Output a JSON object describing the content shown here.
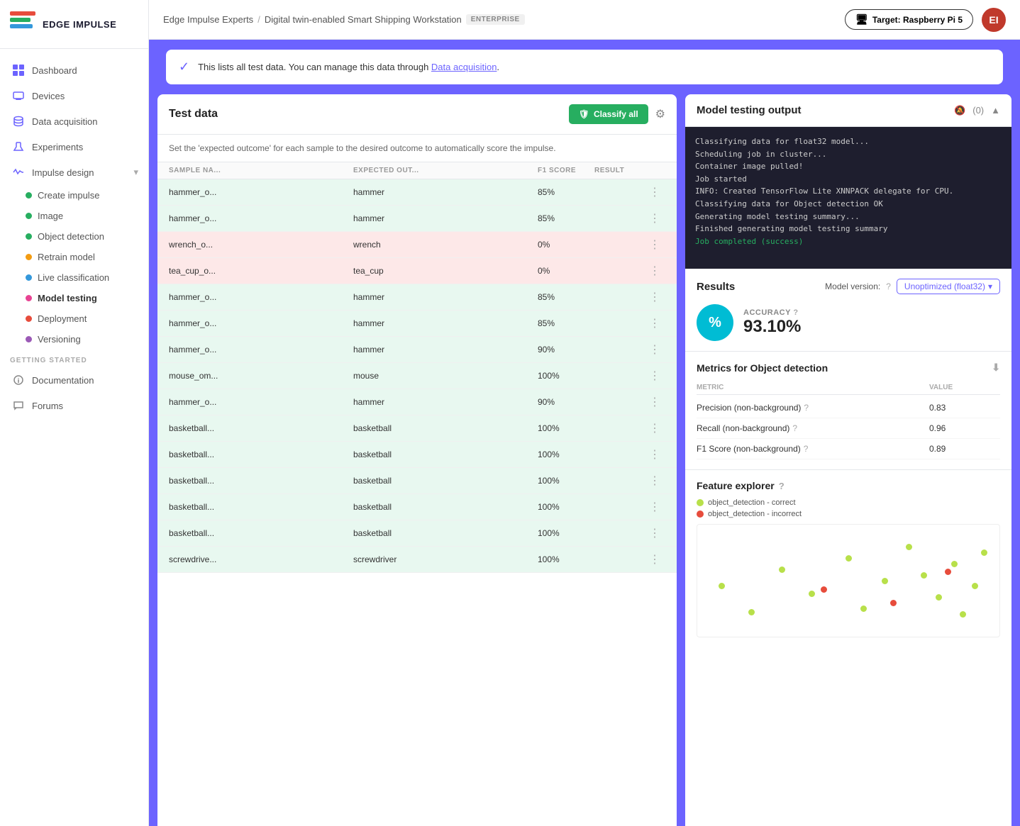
{
  "app": {
    "name": "EDGE IMPULSE"
  },
  "header": {
    "breadcrumb_project": "Edge Impulse Experts",
    "breadcrumb_sep": "/",
    "breadcrumb_page": "Digital twin-enabled Smart Shipping Workstation",
    "badge": "ENTERPRISE",
    "target_label": "Target: Raspberry Pi 5",
    "avatar_initials": "EI"
  },
  "sidebar": {
    "nav_items": [
      {
        "id": "dashboard",
        "label": "Dashboard",
        "icon": "grid"
      },
      {
        "id": "devices",
        "label": "Devices",
        "icon": "devices",
        "active": false
      },
      {
        "id": "data-acquisition",
        "label": "Data acquisition",
        "icon": "database"
      },
      {
        "id": "experiments",
        "label": "Experiments",
        "icon": "experiments"
      },
      {
        "id": "impulse-design",
        "label": "Impulse design",
        "icon": "impulse",
        "has_arrow": true
      }
    ],
    "submenu": [
      {
        "id": "create-impulse",
        "label": "Create impulse",
        "dot": "green"
      },
      {
        "id": "image",
        "label": "Image",
        "dot": "green"
      },
      {
        "id": "object-detection",
        "label": "Object detection",
        "dot": "green"
      },
      {
        "id": "retrain-model",
        "label": "Retrain model",
        "dot": "yellow"
      },
      {
        "id": "live-classification",
        "label": "Live classification",
        "dot": "blue"
      },
      {
        "id": "model-testing",
        "label": "Model testing",
        "dot": "pink",
        "active": true
      },
      {
        "id": "deployment",
        "label": "Deployment",
        "dot": "red"
      },
      {
        "id": "versioning",
        "label": "Versioning",
        "dot": "purple"
      }
    ],
    "getting_started_label": "GETTING STARTED",
    "getting_started_items": [
      {
        "id": "documentation",
        "label": "Documentation",
        "icon": "doc"
      },
      {
        "id": "forums",
        "label": "Forums",
        "icon": "forum"
      }
    ]
  },
  "alert": {
    "text_before": "This lists all test data. You can manage this data through",
    "link_text": "Data acquisition",
    "text_after": "."
  },
  "test_data": {
    "title": "Test data",
    "classify_btn": "Classify all",
    "description": "Set the 'expected outcome' for each sample to the desired outcome to automatically score the impulse.",
    "columns": [
      "SAMPLE NA...",
      "EXPECTED OUT...",
      "F1 SCORE",
      "RESULT",
      ""
    ],
    "rows": [
      {
        "name": "hammer_o...",
        "expected": "hammer",
        "f1": "85%",
        "result": "",
        "color": "green"
      },
      {
        "name": "hammer_o...",
        "expected": "hammer",
        "f1": "85%",
        "result": "",
        "color": "green"
      },
      {
        "name": "wrench_o...",
        "expected": "wrench",
        "f1": "0%",
        "result": "",
        "color": "red"
      },
      {
        "name": "tea_cup_o...",
        "expected": "tea_cup",
        "f1": "0%",
        "result": "",
        "color": "red"
      },
      {
        "name": "hammer_o...",
        "expected": "hammer",
        "f1": "85%",
        "result": "",
        "color": "green"
      },
      {
        "name": "hammer_o...",
        "expected": "hammer",
        "f1": "85%",
        "result": "",
        "color": "green"
      },
      {
        "name": "hammer_o...",
        "expected": "hammer",
        "f1": "90%",
        "result": "",
        "color": "green"
      },
      {
        "name": "mouse_om...",
        "expected": "mouse",
        "f1": "100%",
        "result": "",
        "color": "green"
      },
      {
        "name": "hammer_o...",
        "expected": "hammer",
        "f1": "90%",
        "result": "",
        "color": "green"
      },
      {
        "name": "basketball...",
        "expected": "basketball",
        "f1": "100%",
        "result": "",
        "color": "green"
      },
      {
        "name": "basketball...",
        "expected": "basketball",
        "f1": "100%",
        "result": "",
        "color": "green"
      },
      {
        "name": "basketball...",
        "expected": "basketball",
        "f1": "100%",
        "result": "",
        "color": "green"
      },
      {
        "name": "basketball...",
        "expected": "basketball",
        "f1": "100%",
        "result": "",
        "color": "green"
      },
      {
        "name": "basketball...",
        "expected": "basketball",
        "f1": "100%",
        "result": "",
        "color": "green"
      },
      {
        "name": "screwdrive...",
        "expected": "screwdriver",
        "f1": "100%",
        "result": "",
        "color": "green"
      }
    ]
  },
  "model_output": {
    "title": "Model testing output",
    "notifications": "(0)",
    "log_lines": [
      "Classifying data for float32 model...",
      "Scheduling job in cluster...",
      "Container image pulled!",
      "Job started",
      "INFO: Created TensorFlow Lite XNNPACK delegate for CPU.",
      "",
      "Classifying data for Object detection OK",
      "",
      "Generating model testing summary...",
      "Finished generating model testing summary",
      "",
      "Job completed (success)"
    ],
    "log_success_line": "Job completed (success)"
  },
  "results": {
    "title": "Results",
    "model_version_label": "Model version:",
    "model_version_value": "Unoptimized (float32)",
    "accuracy_label": "ACCURACY",
    "accuracy_value": "93.10%",
    "accuracy_icon": "%",
    "section_title": "Metrics for Object detection",
    "metrics_columns": [
      "METRIC",
      "VALUE"
    ],
    "metrics": [
      {
        "label": "Precision (non-background)",
        "value": "0.83"
      },
      {
        "label": "Recall (non-background)",
        "value": "0.96"
      },
      {
        "label": "F1 Score (non-background)",
        "value": "0.89"
      }
    ],
    "feature_explorer_title": "Feature explorer",
    "legend": [
      {
        "label": "object_detection - correct",
        "color": "green"
      },
      {
        "label": "object_detection - incorrect",
        "color": "red"
      }
    ],
    "scatter_dots": [
      {
        "x": 8,
        "y": 55,
        "color": "#b8e04a",
        "size": 9
      },
      {
        "x": 18,
        "y": 78,
        "color": "#b8e04a",
        "size": 9
      },
      {
        "x": 28,
        "y": 40,
        "color": "#b8e04a",
        "size": 9
      },
      {
        "x": 38,
        "y": 62,
        "color": "#b8e04a",
        "size": 9
      },
      {
        "x": 50,
        "y": 30,
        "color": "#b8e04a",
        "size": 9
      },
      {
        "x": 55,
        "y": 75,
        "color": "#b8e04a",
        "size": 9
      },
      {
        "x": 62,
        "y": 50,
        "color": "#b8e04a",
        "size": 9
      },
      {
        "x": 70,
        "y": 20,
        "color": "#b8e04a",
        "size": 9
      },
      {
        "x": 75,
        "y": 45,
        "color": "#b8e04a",
        "size": 9
      },
      {
        "x": 80,
        "y": 65,
        "color": "#b8e04a",
        "size": 9
      },
      {
        "x": 85,
        "y": 35,
        "color": "#b8e04a",
        "size": 9
      },
      {
        "x": 88,
        "y": 80,
        "color": "#b8e04a",
        "size": 9
      },
      {
        "x": 92,
        "y": 55,
        "color": "#b8e04a",
        "size": 9
      },
      {
        "x": 95,
        "y": 25,
        "color": "#b8e04a",
        "size": 9
      },
      {
        "x": 42,
        "y": 58,
        "color": "#e74c3c",
        "size": 9
      },
      {
        "x": 65,
        "y": 70,
        "color": "#e74c3c",
        "size": 9
      },
      {
        "x": 83,
        "y": 42,
        "color": "#e74c3c",
        "size": 9
      }
    ]
  }
}
